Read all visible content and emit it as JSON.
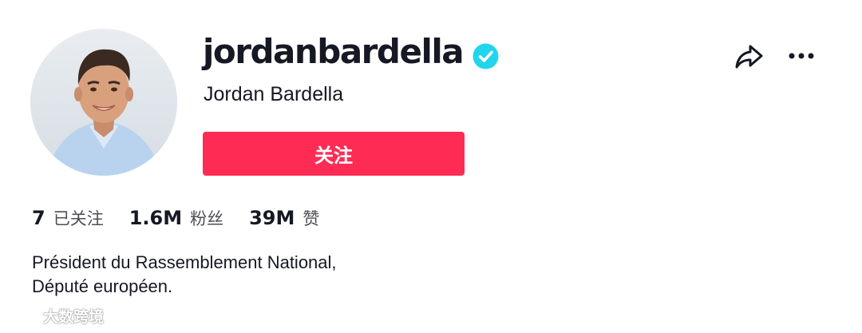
{
  "profile": {
    "username": "jordanbardella",
    "display_name": "Jordan Bardella",
    "verified": true,
    "follow_label": "关注"
  },
  "stats": [
    {
      "value": "7",
      "label": "已关注"
    },
    {
      "value": "1.6M",
      "label": "粉丝"
    },
    {
      "value": "39M",
      "label": "赞"
    }
  ],
  "bio": {
    "line1": "Président du Rassemblement National,",
    "line2": "Député européen."
  },
  "watermark": {
    "text": "大数跨境"
  },
  "colors": {
    "follow_button": "#fe2c55",
    "verified_badge": "#20d5ec",
    "text_primary": "#161823",
    "text_secondary": "#4e4f55"
  },
  "icons": [
    "verified-badge-icon",
    "share-icon",
    "more-options-icon"
  ]
}
